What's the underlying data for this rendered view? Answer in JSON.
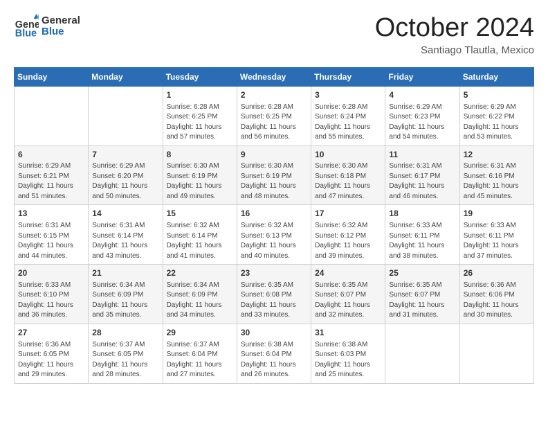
{
  "logo": {
    "line1": "General",
    "line2": "Blue"
  },
  "header": {
    "month": "October 2024",
    "location": "Santiago Tlautla, Mexico"
  },
  "weekdays": [
    "Sunday",
    "Monday",
    "Tuesday",
    "Wednesday",
    "Thursday",
    "Friday",
    "Saturday"
  ],
  "weeks": [
    [
      {
        "day": "",
        "info": ""
      },
      {
        "day": "",
        "info": ""
      },
      {
        "day": "1",
        "info": "Sunrise: 6:28 AM\nSunset: 6:25 PM\nDaylight: 11 hours and 57 minutes."
      },
      {
        "day": "2",
        "info": "Sunrise: 6:28 AM\nSunset: 6:25 PM\nDaylight: 11 hours and 56 minutes."
      },
      {
        "day": "3",
        "info": "Sunrise: 6:28 AM\nSunset: 6:24 PM\nDaylight: 11 hours and 55 minutes."
      },
      {
        "day": "4",
        "info": "Sunrise: 6:29 AM\nSunset: 6:23 PM\nDaylight: 11 hours and 54 minutes."
      },
      {
        "day": "5",
        "info": "Sunrise: 6:29 AM\nSunset: 6:22 PM\nDaylight: 11 hours and 53 minutes."
      }
    ],
    [
      {
        "day": "6",
        "info": "Sunrise: 6:29 AM\nSunset: 6:21 PM\nDaylight: 11 hours and 51 minutes."
      },
      {
        "day": "7",
        "info": "Sunrise: 6:29 AM\nSunset: 6:20 PM\nDaylight: 11 hours and 50 minutes."
      },
      {
        "day": "8",
        "info": "Sunrise: 6:30 AM\nSunset: 6:19 PM\nDaylight: 11 hours and 49 minutes."
      },
      {
        "day": "9",
        "info": "Sunrise: 6:30 AM\nSunset: 6:19 PM\nDaylight: 11 hours and 48 minutes."
      },
      {
        "day": "10",
        "info": "Sunrise: 6:30 AM\nSunset: 6:18 PM\nDaylight: 11 hours and 47 minutes."
      },
      {
        "day": "11",
        "info": "Sunrise: 6:31 AM\nSunset: 6:17 PM\nDaylight: 11 hours and 46 minutes."
      },
      {
        "day": "12",
        "info": "Sunrise: 6:31 AM\nSunset: 6:16 PM\nDaylight: 11 hours and 45 minutes."
      }
    ],
    [
      {
        "day": "13",
        "info": "Sunrise: 6:31 AM\nSunset: 6:15 PM\nDaylight: 11 hours and 44 minutes."
      },
      {
        "day": "14",
        "info": "Sunrise: 6:31 AM\nSunset: 6:14 PM\nDaylight: 11 hours and 43 minutes."
      },
      {
        "day": "15",
        "info": "Sunrise: 6:32 AM\nSunset: 6:14 PM\nDaylight: 11 hours and 41 minutes."
      },
      {
        "day": "16",
        "info": "Sunrise: 6:32 AM\nSunset: 6:13 PM\nDaylight: 11 hours and 40 minutes."
      },
      {
        "day": "17",
        "info": "Sunrise: 6:32 AM\nSunset: 6:12 PM\nDaylight: 11 hours and 39 minutes."
      },
      {
        "day": "18",
        "info": "Sunrise: 6:33 AM\nSunset: 6:11 PM\nDaylight: 11 hours and 38 minutes."
      },
      {
        "day": "19",
        "info": "Sunrise: 6:33 AM\nSunset: 6:11 PM\nDaylight: 11 hours and 37 minutes."
      }
    ],
    [
      {
        "day": "20",
        "info": "Sunrise: 6:33 AM\nSunset: 6:10 PM\nDaylight: 11 hours and 36 minutes."
      },
      {
        "day": "21",
        "info": "Sunrise: 6:34 AM\nSunset: 6:09 PM\nDaylight: 11 hours and 35 minutes."
      },
      {
        "day": "22",
        "info": "Sunrise: 6:34 AM\nSunset: 6:09 PM\nDaylight: 11 hours and 34 minutes."
      },
      {
        "day": "23",
        "info": "Sunrise: 6:35 AM\nSunset: 6:08 PM\nDaylight: 11 hours and 33 minutes."
      },
      {
        "day": "24",
        "info": "Sunrise: 6:35 AM\nSunset: 6:07 PM\nDaylight: 11 hours and 32 minutes."
      },
      {
        "day": "25",
        "info": "Sunrise: 6:35 AM\nSunset: 6:07 PM\nDaylight: 11 hours and 31 minutes."
      },
      {
        "day": "26",
        "info": "Sunrise: 6:36 AM\nSunset: 6:06 PM\nDaylight: 11 hours and 30 minutes."
      }
    ],
    [
      {
        "day": "27",
        "info": "Sunrise: 6:36 AM\nSunset: 6:05 PM\nDaylight: 11 hours and 29 minutes."
      },
      {
        "day": "28",
        "info": "Sunrise: 6:37 AM\nSunset: 6:05 PM\nDaylight: 11 hours and 28 minutes."
      },
      {
        "day": "29",
        "info": "Sunrise: 6:37 AM\nSunset: 6:04 PM\nDaylight: 11 hours and 27 minutes."
      },
      {
        "day": "30",
        "info": "Sunrise: 6:38 AM\nSunset: 6:04 PM\nDaylight: 11 hours and 26 minutes."
      },
      {
        "day": "31",
        "info": "Sunrise: 6:38 AM\nSunset: 6:03 PM\nDaylight: 11 hours and 25 minutes."
      },
      {
        "day": "",
        "info": ""
      },
      {
        "day": "",
        "info": ""
      }
    ]
  ]
}
